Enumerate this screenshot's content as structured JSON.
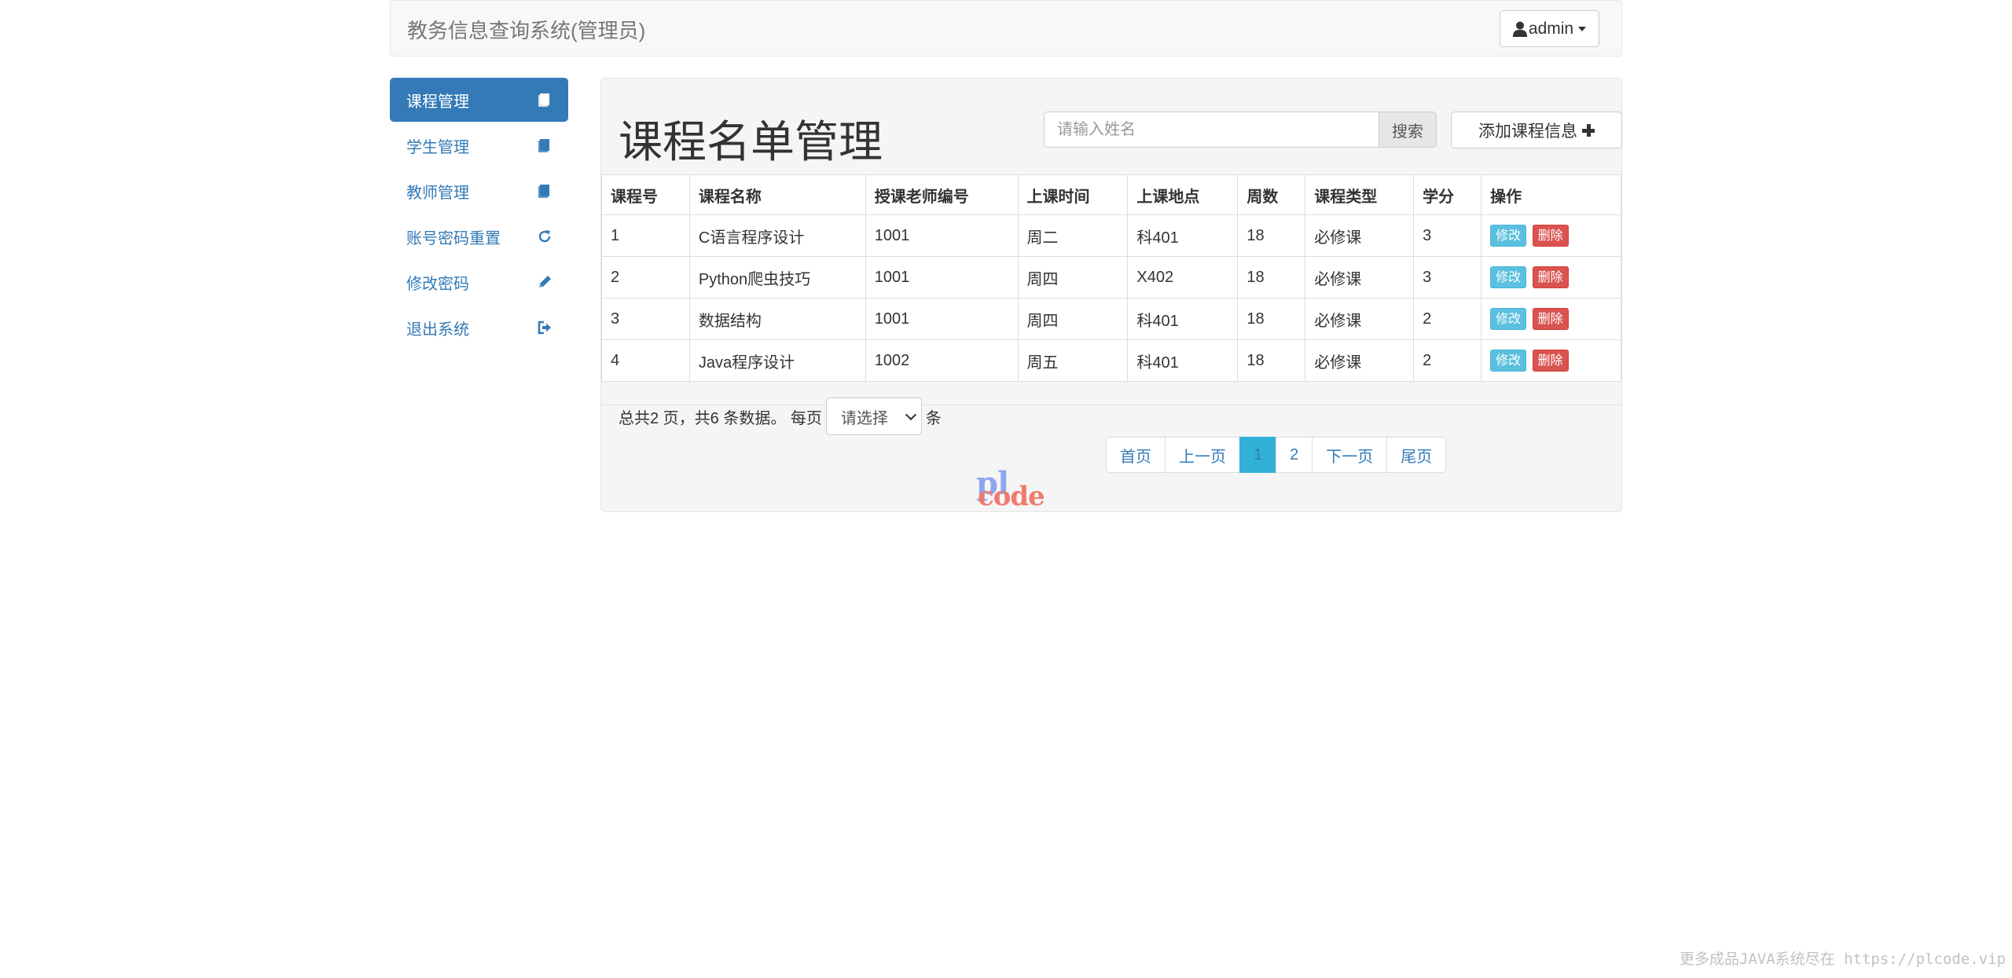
{
  "header": {
    "title": "教务信息查询系统(管理员)",
    "user_label": "admin",
    "user_icon": "user-icon",
    "caret_icon": "caret-down-icon"
  },
  "sidebar": {
    "items": [
      {
        "label": "课程管理",
        "icon": "book-icon",
        "active": true
      },
      {
        "label": "学生管理",
        "icon": "book-icon",
        "active": false
      },
      {
        "label": "教师管理",
        "icon": "book-icon",
        "active": false
      },
      {
        "label": "账号密码重置",
        "icon": "refresh-icon",
        "active": false
      },
      {
        "label": "修改密码",
        "icon": "pencil-icon",
        "active": false
      },
      {
        "label": "退出系统",
        "icon": "logout-icon",
        "active": false
      }
    ]
  },
  "main": {
    "title": "课程名单管理",
    "search": {
      "placeholder": "请输入姓名",
      "value": "",
      "button": "搜索"
    },
    "add_button": "添加课程信息",
    "table": {
      "columns": [
        "课程号",
        "课程名称",
        "授课老师编号",
        "上课时间",
        "上课地点",
        "周数",
        "课程类型",
        "学分",
        "操作"
      ],
      "rows": [
        [
          "1",
          "C语言程序设计",
          "1001",
          "周二",
          "科401",
          "18",
          "必修课",
          "3"
        ],
        [
          "2",
          "Python爬虫技巧",
          "1001",
          "周四",
          "X402",
          "18",
          "必修课",
          "3"
        ],
        [
          "3",
          "数据结构",
          "1001",
          "周四",
          "科401",
          "18",
          "必修课",
          "2"
        ],
        [
          "4",
          "Java程序设计",
          "1002",
          "周五",
          "科401",
          "18",
          "必修课",
          "2"
        ]
      ],
      "edit_label": "修改",
      "delete_label": "删除"
    },
    "summary": {
      "text": "总共2 页，共6 条数据。 每页",
      "select_value": "请选择",
      "suffix": "条"
    },
    "pagination": {
      "first": "首页",
      "prev": "上一页",
      "pages": [
        "1",
        "2"
      ],
      "current": "1",
      "next": "下一页",
      "last": "尾页"
    }
  },
  "watermark": {
    "logo_top": "pl",
    "logo_bottom": "code"
  },
  "footer_note": "更多成品JAVA系统尽在 https://plcode.vip",
  "colors": {
    "primary": "#337ab7",
    "info": "#5bc0de",
    "danger": "#d9534f",
    "active_page": "#31b0d5"
  }
}
